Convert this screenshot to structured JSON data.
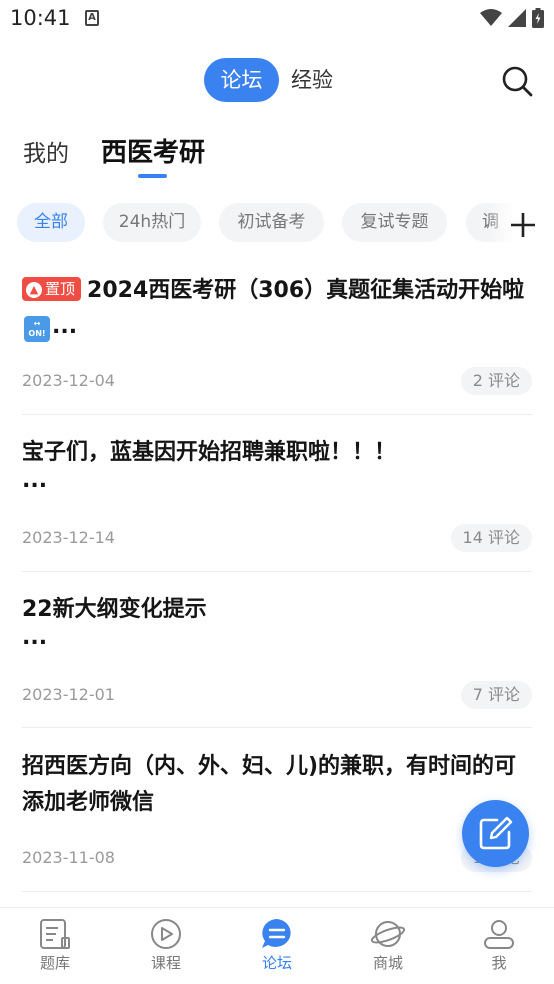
{
  "status_bar": {
    "time": "10:41",
    "notif_icon": "A"
  },
  "top_switch": {
    "active": "论坛",
    "inactive": "经验"
  },
  "sub_tabs": [
    "我的",
    "西医考研"
  ],
  "chips": [
    "全部",
    "24h热门",
    "初试备考",
    "复试专题",
    "调"
  ],
  "posts": [
    {
      "pin_label": "置顶",
      "title": "2024西医考研（306）真题征集活动开始啦",
      "ellipsis": "...",
      "date": "2023-12-04",
      "comments": "2 评论"
    },
    {
      "title": "宝子们，蓝基因开始招聘兼职啦！！！",
      "ellipsis": "...",
      "date": "2023-12-14",
      "comments": "14 评论"
    },
    {
      "title": "22新大纲变化提示",
      "ellipsis": "...",
      "date": "2023-12-01",
      "comments": "7 评论"
    },
    {
      "title": "招西医方向（内、外、妇、儿)的兼职，有时间的可添加老师微信",
      "date": "2023-11-08",
      "comments": "1 评论"
    }
  ],
  "on_icon_text": "ON!",
  "bottom_nav": [
    {
      "label": "题库",
      "icon": "document-icon"
    },
    {
      "label": "课程",
      "icon": "play-icon"
    },
    {
      "label": "论坛",
      "icon": "chat-icon",
      "active": true
    },
    {
      "label": "商城",
      "icon": "planet-icon"
    },
    {
      "label": "我",
      "icon": "person-icon"
    }
  ],
  "colors": {
    "accent": "#3a82f0",
    "pin": "#f04e45"
  }
}
